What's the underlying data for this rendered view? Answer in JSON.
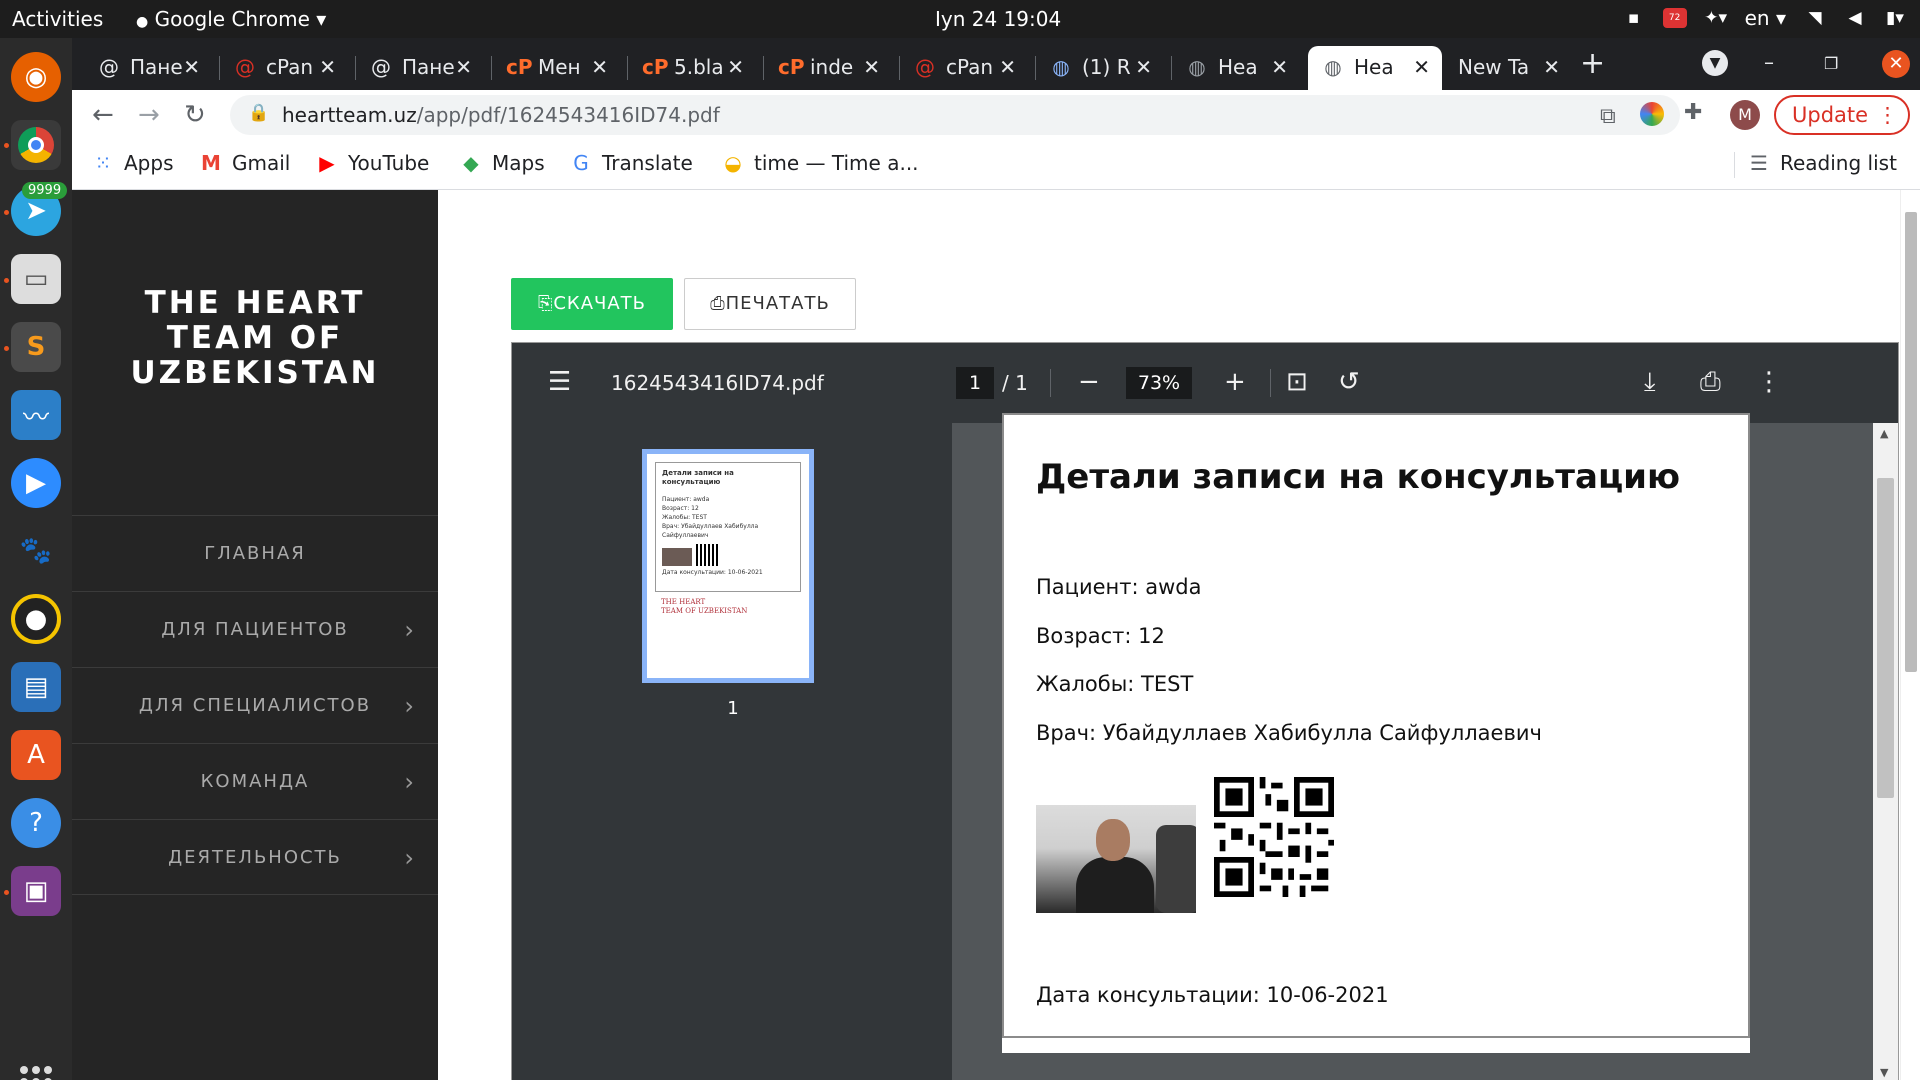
{
  "system": {
    "activities": "Activities",
    "app_menu": "Google Chrome ▾",
    "clock": "Iyn 24  19:04",
    "language": "en ▾",
    "battery_badge": "72"
  },
  "dock": {
    "telegram_badge": "9999"
  },
  "tabs": [
    {
      "title": "Пане",
      "favicon": "at-icon"
    },
    {
      "title": "cPan",
      "favicon": "cpanel-red-icon"
    },
    {
      "title": "Пане",
      "favicon": "at-icon"
    },
    {
      "title": "Мен",
      "favicon": "cpanel-icon"
    },
    {
      "title": "5.bla",
      "favicon": "cpanel-icon"
    },
    {
      "title": "inde",
      "favicon": "cpanel-icon"
    },
    {
      "title": "cPan",
      "favicon": "cpanel-red-icon"
    },
    {
      "title": "(1) R",
      "favicon": "globe-icon"
    },
    {
      "title": "Hea",
      "favicon": "globe-icon"
    },
    {
      "title": "Hea",
      "favicon": "globe-icon",
      "active": true
    },
    {
      "title": "New Ta",
      "favicon": ""
    }
  ],
  "address_bar": {
    "domain": "heartteam.uz",
    "path": "/app/pdf/1624543416ID74.pdf"
  },
  "profile_initial": "M",
  "update_label": "Update",
  "bookmarks": {
    "apps": "Apps",
    "gmail": "Gmail",
    "youtube": "YouTube",
    "maps": "Maps",
    "translate": "Translate",
    "time": "time — Time a...",
    "reading_list": "Reading list"
  },
  "site": {
    "logo_lines": [
      "THE HEART",
      "TEAM OF",
      "UZBEKISTAN"
    ],
    "menu": [
      {
        "label": "ГЛАВНАЯ",
        "has_chevron": false
      },
      {
        "label": "ДЛЯ ПАЦИЕНТОВ",
        "has_chevron": true
      },
      {
        "label": "ДЛЯ СПЕЦИАЛИСТОВ",
        "has_chevron": true
      },
      {
        "label": "КОМАНДА",
        "has_chevron": true
      },
      {
        "label": "ДЕЯТЕЛЬНОСТЬ",
        "has_chevron": true
      }
    ],
    "download_label": "СКАЧАТЬ",
    "print_label": "ПЕЧАТАТЬ"
  },
  "pdf_viewer": {
    "filename": "1624543416ID74.pdf",
    "page_current": "1",
    "page_total": "/  1",
    "zoom": "73%",
    "thumbnail_number": "1",
    "thumbnail": {
      "title": "Детали записи на консультацию",
      "lines": [
        "Пациент: awda",
        "Возраст: 12",
        "Жалобы: TEST",
        "Врач: Убайдуллаев Хабибулла Сайфуллаевич"
      ],
      "date": "Дата консультации: 10-06-2021",
      "logo_lines": [
        "THE HEART",
        "TEAM OF UZBEKISTAN"
      ]
    },
    "document": {
      "title": "Детали записи на консультацию",
      "patient": "Пациент: awda",
      "age": "Возраст: 12",
      "complaints": "Жалобы: TEST",
      "doctor": "Врач: Убайдуллаев Хабибулла Сайфуллаевич",
      "date": "Дата консультации: 10-06-2021"
    }
  }
}
